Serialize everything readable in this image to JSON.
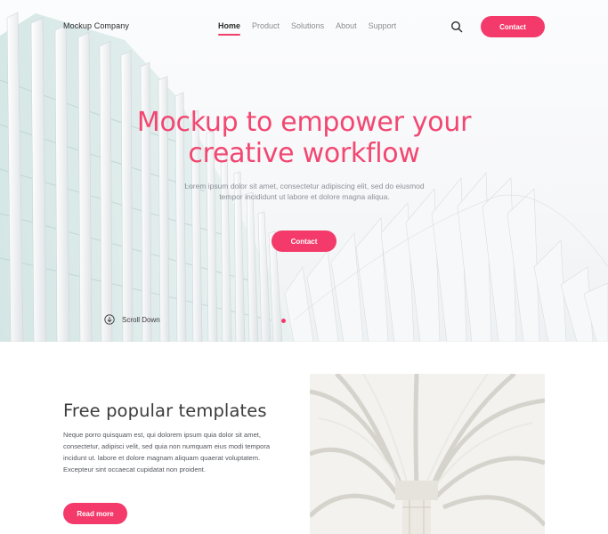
{
  "brand": "Mockup Company",
  "nav": {
    "items": [
      {
        "label": "Home",
        "active": true
      },
      {
        "label": "Product",
        "active": false
      },
      {
        "label": "Solutions",
        "active": false
      },
      {
        "label": "About",
        "active": false
      },
      {
        "label": "Support",
        "active": false
      }
    ],
    "search_icon": "search-icon",
    "contact_label": "Contact"
  },
  "hero": {
    "headline": "Mockup to empower your creative workflow",
    "subline": "Lorem ipsum dolor sit amet, consectetur adipiscing elit, sed do eiusmod tempor incididunt ut labore et dolore magna aliqua.",
    "contact_label": "Contact",
    "scroll_label": "Scroll Down",
    "scroll_icon": "arrow-down-circle-icon",
    "slide_indicator_active": 1
  },
  "feature": {
    "title": "Free popular templates",
    "body": "Neque porro quisquam est, qui dolorem ipsum quia dolor sit amet, consectetur, adipisci velit, sed quia non numquam eius modi tempora incidunt ut. labore et dolore magnam aliquam quaerat voluptatem. Excepteur sint occaecat cupidatat non proident.",
    "button_label": "Read more"
  },
  "colors": {
    "accent": "#f33a6a",
    "headline": "#f24771",
    "text": "#3c3c3c",
    "muted": "#8b9097"
  }
}
